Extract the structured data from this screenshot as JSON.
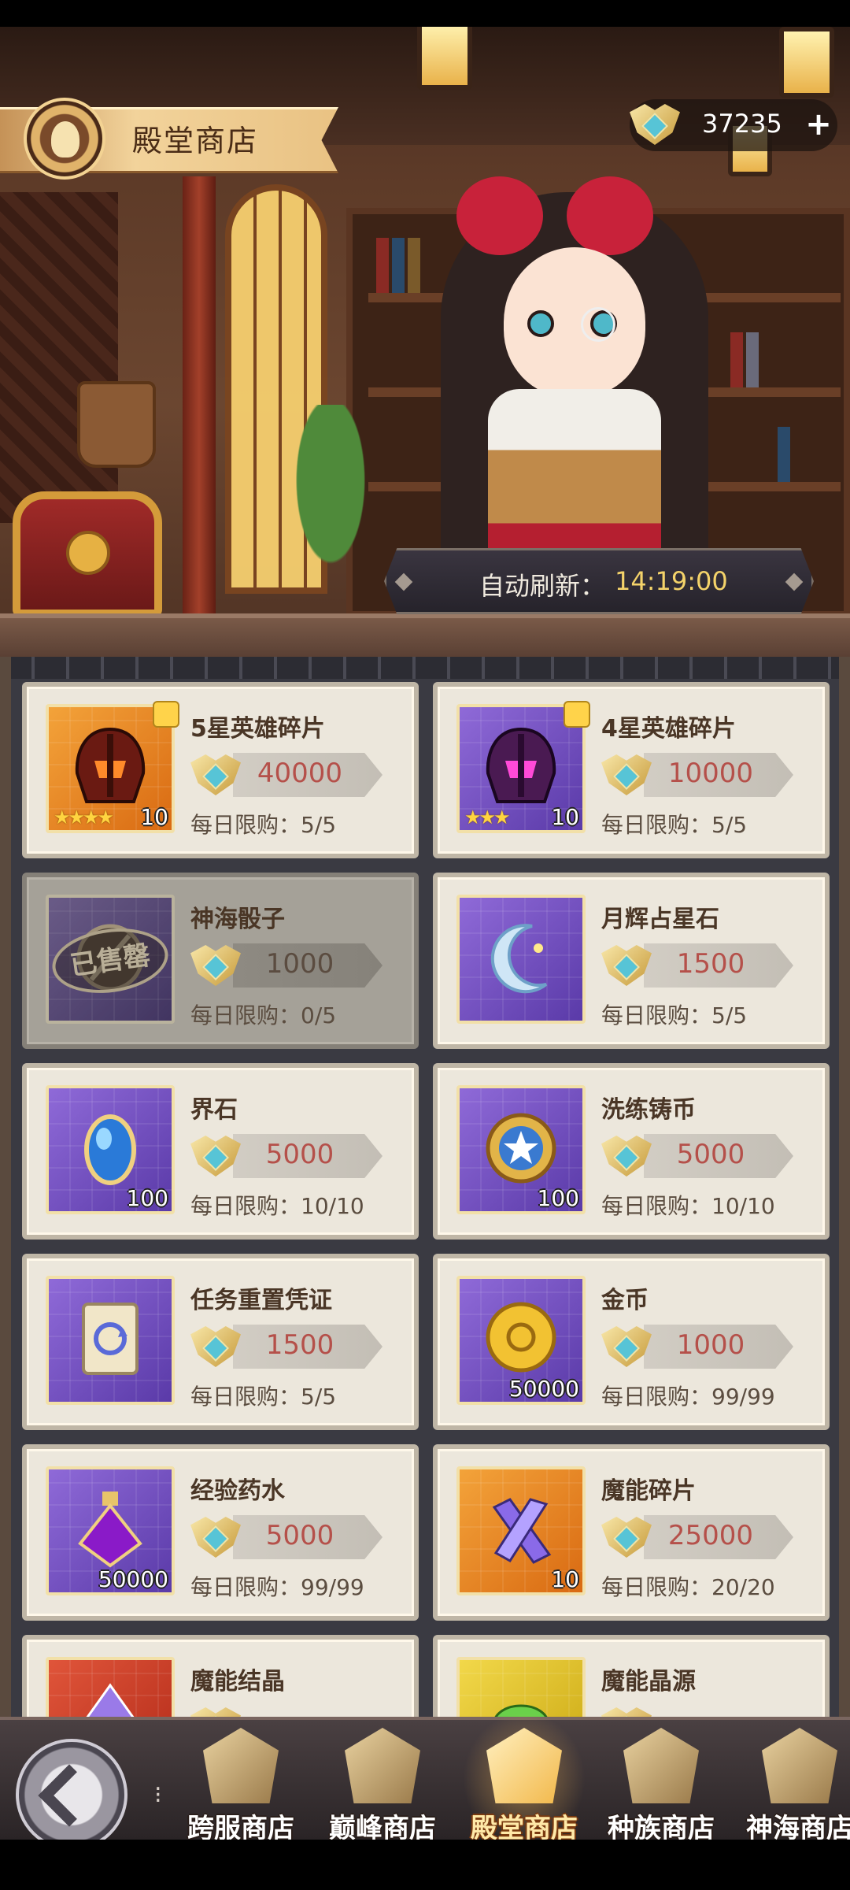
{
  "header": {
    "shop_title": "殿堂商店",
    "currency_amount": "37235",
    "currency_plus": "+",
    "currency_icon": "hall-crest-icon"
  },
  "refresh": {
    "label": "自动刷新：",
    "time": "14:19:00"
  },
  "items": [
    {
      "name": "5星英雄碎片",
      "price": "40000",
      "limit": "每日限购：5/5",
      "qty": "10",
      "stars": "★★★★",
      "sold": false,
      "icon": "helmet-red-icon"
    },
    {
      "name": "4星英雄碎片",
      "price": "10000",
      "limit": "每日限购：5/5",
      "qty": "10",
      "stars": "★★★",
      "sold": false,
      "icon": "helmet-purple-icon"
    },
    {
      "name": "神海骰子",
      "price": "1000",
      "limit": "每日限购：0/5",
      "qty": "",
      "sold": true,
      "sold_label": "已售罄",
      "icon": "dice-icon"
    },
    {
      "name": "月辉占星石",
      "price": "1500",
      "limit": "每日限购：5/5",
      "qty": "",
      "sold": false,
      "icon": "crescent-moon-icon"
    },
    {
      "name": "界石",
      "price": "5000",
      "limit": "每日限购：10/10",
      "qty": "100",
      "sold": false,
      "icon": "blue-crystal-icon"
    },
    {
      "name": "洗练铸币",
      "price": "5000",
      "limit": "每日限购：10/10",
      "qty": "100",
      "sold": false,
      "icon": "star-coin-icon"
    },
    {
      "name": "任务重置凭证",
      "price": "1500",
      "limit": "每日限购：5/5",
      "qty": "",
      "sold": false,
      "icon": "reset-ticket-icon"
    },
    {
      "name": "金币",
      "price": "1000",
      "limit": "每日限购：99/99",
      "qty": "50000",
      "sold": false,
      "icon": "gold-coin-icon"
    },
    {
      "name": "经验药水",
      "price": "5000",
      "limit": "每日限购：99/99",
      "qty": "50000",
      "sold": false,
      "icon": "potion-icon"
    },
    {
      "name": "魔能碎片",
      "price": "25000",
      "limit": "每日限购：20/20",
      "qty": "10",
      "sold": false,
      "icon": "magic-shard-icon"
    },
    {
      "name": "魔能结晶",
      "price": "",
      "limit": "",
      "qty": "",
      "sold": false,
      "icon": "magic-crystal-icon"
    },
    {
      "name": "魔能晶源",
      "price": "",
      "limit": "",
      "qty": "",
      "sold": false,
      "icon": "magic-source-icon"
    }
  ],
  "nav": {
    "separator": "⁝",
    "tabs": [
      {
        "label": "跨服商店"
      },
      {
        "label": "巅峰商店"
      },
      {
        "label": "殿堂商店",
        "active": true
      },
      {
        "label": "种族商店"
      },
      {
        "label": "神海商店"
      }
    ]
  }
}
